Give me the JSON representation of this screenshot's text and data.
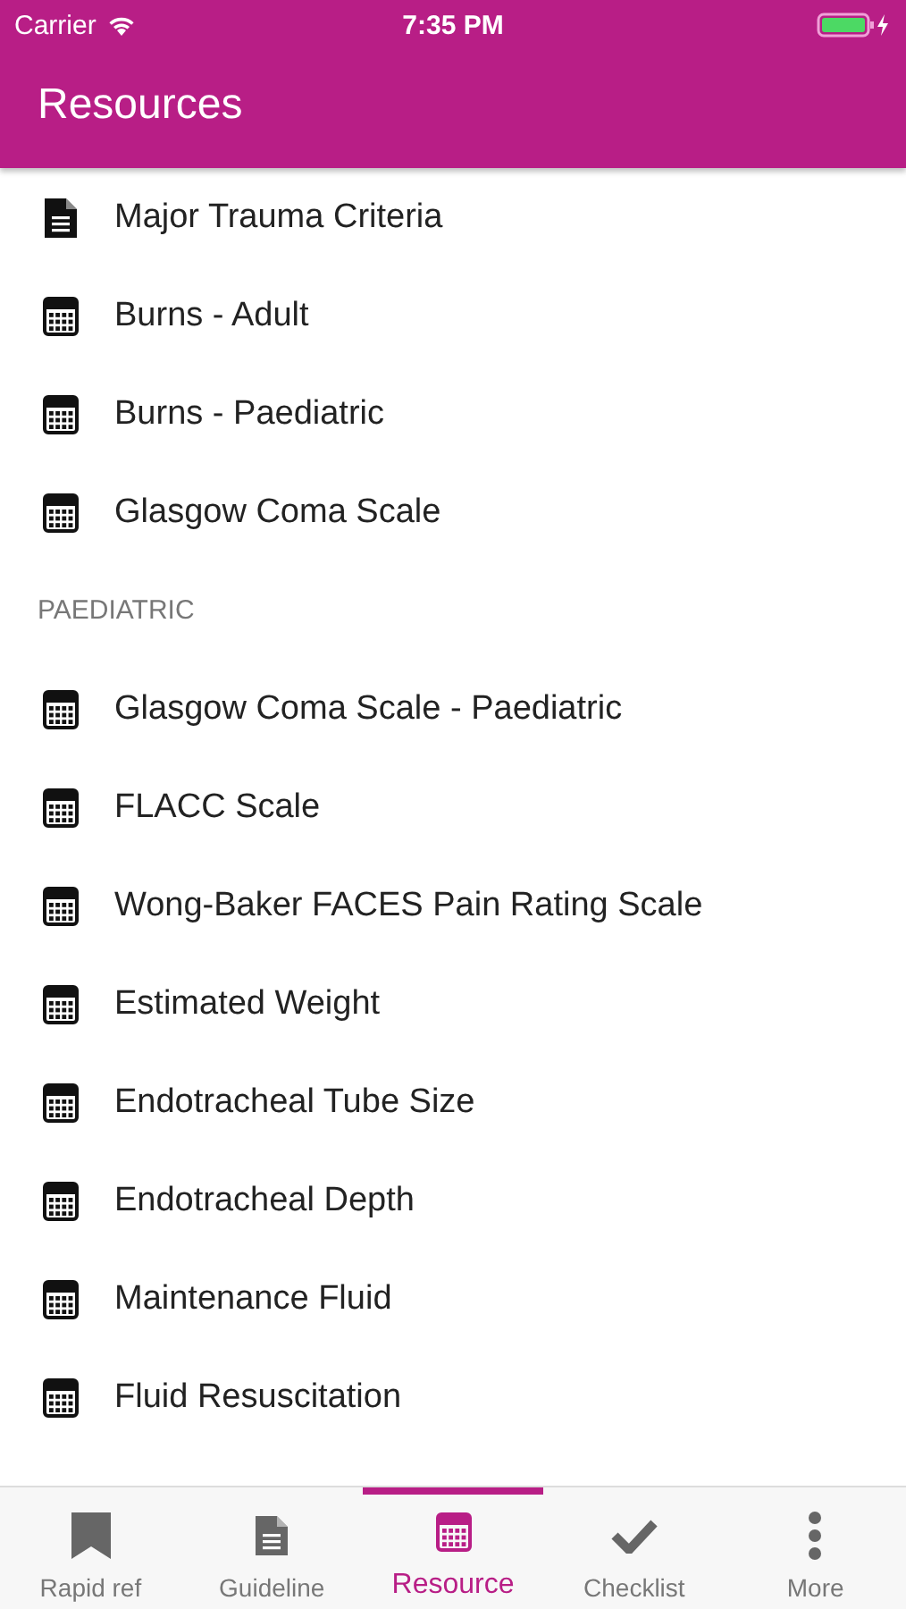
{
  "status_bar": {
    "carrier": "Carrier",
    "time": "7:35 PM",
    "battery": {
      "level": 1,
      "charging": true
    }
  },
  "header": {
    "title": "Resources"
  },
  "sections": [
    {
      "items": [
        {
          "label": "Major Trauma Criteria",
          "kind": "document"
        },
        {
          "label": "Burns - Adult",
          "kind": "calculator"
        },
        {
          "label": "Burns - Paediatric",
          "kind": "calculator"
        },
        {
          "label": "Glasgow Coma Scale",
          "kind": "calculator"
        }
      ]
    },
    {
      "title": "PAEDIATRIC",
      "items": [
        {
          "label": "Glasgow Coma Scale - Paediatric",
          "kind": "calculator"
        },
        {
          "label": "FLACC Scale",
          "kind": "calculator"
        },
        {
          "label": "Wong-Baker FACES Pain Rating Scale",
          "kind": "calculator"
        },
        {
          "label": "Estimated Weight",
          "kind": "calculator"
        },
        {
          "label": "Endotracheal Tube Size",
          "kind": "calculator"
        },
        {
          "label": "Endotracheal Depth",
          "kind": "calculator"
        },
        {
          "label": "Maintenance Fluid",
          "kind": "calculator"
        },
        {
          "label": "Fluid Resuscitation",
          "kind": "calculator"
        }
      ]
    }
  ],
  "tabs": [
    {
      "label": "Rapid ref",
      "kind": "bookmark",
      "selected": false
    },
    {
      "label": "Guideline",
      "kind": "document",
      "selected": false
    },
    {
      "label": "Resource",
      "kind": "calculator",
      "selected": true
    },
    {
      "label": "Checklist",
      "kind": "check",
      "selected": false
    },
    {
      "label": "More",
      "kind": "more",
      "selected": false
    }
  ]
}
